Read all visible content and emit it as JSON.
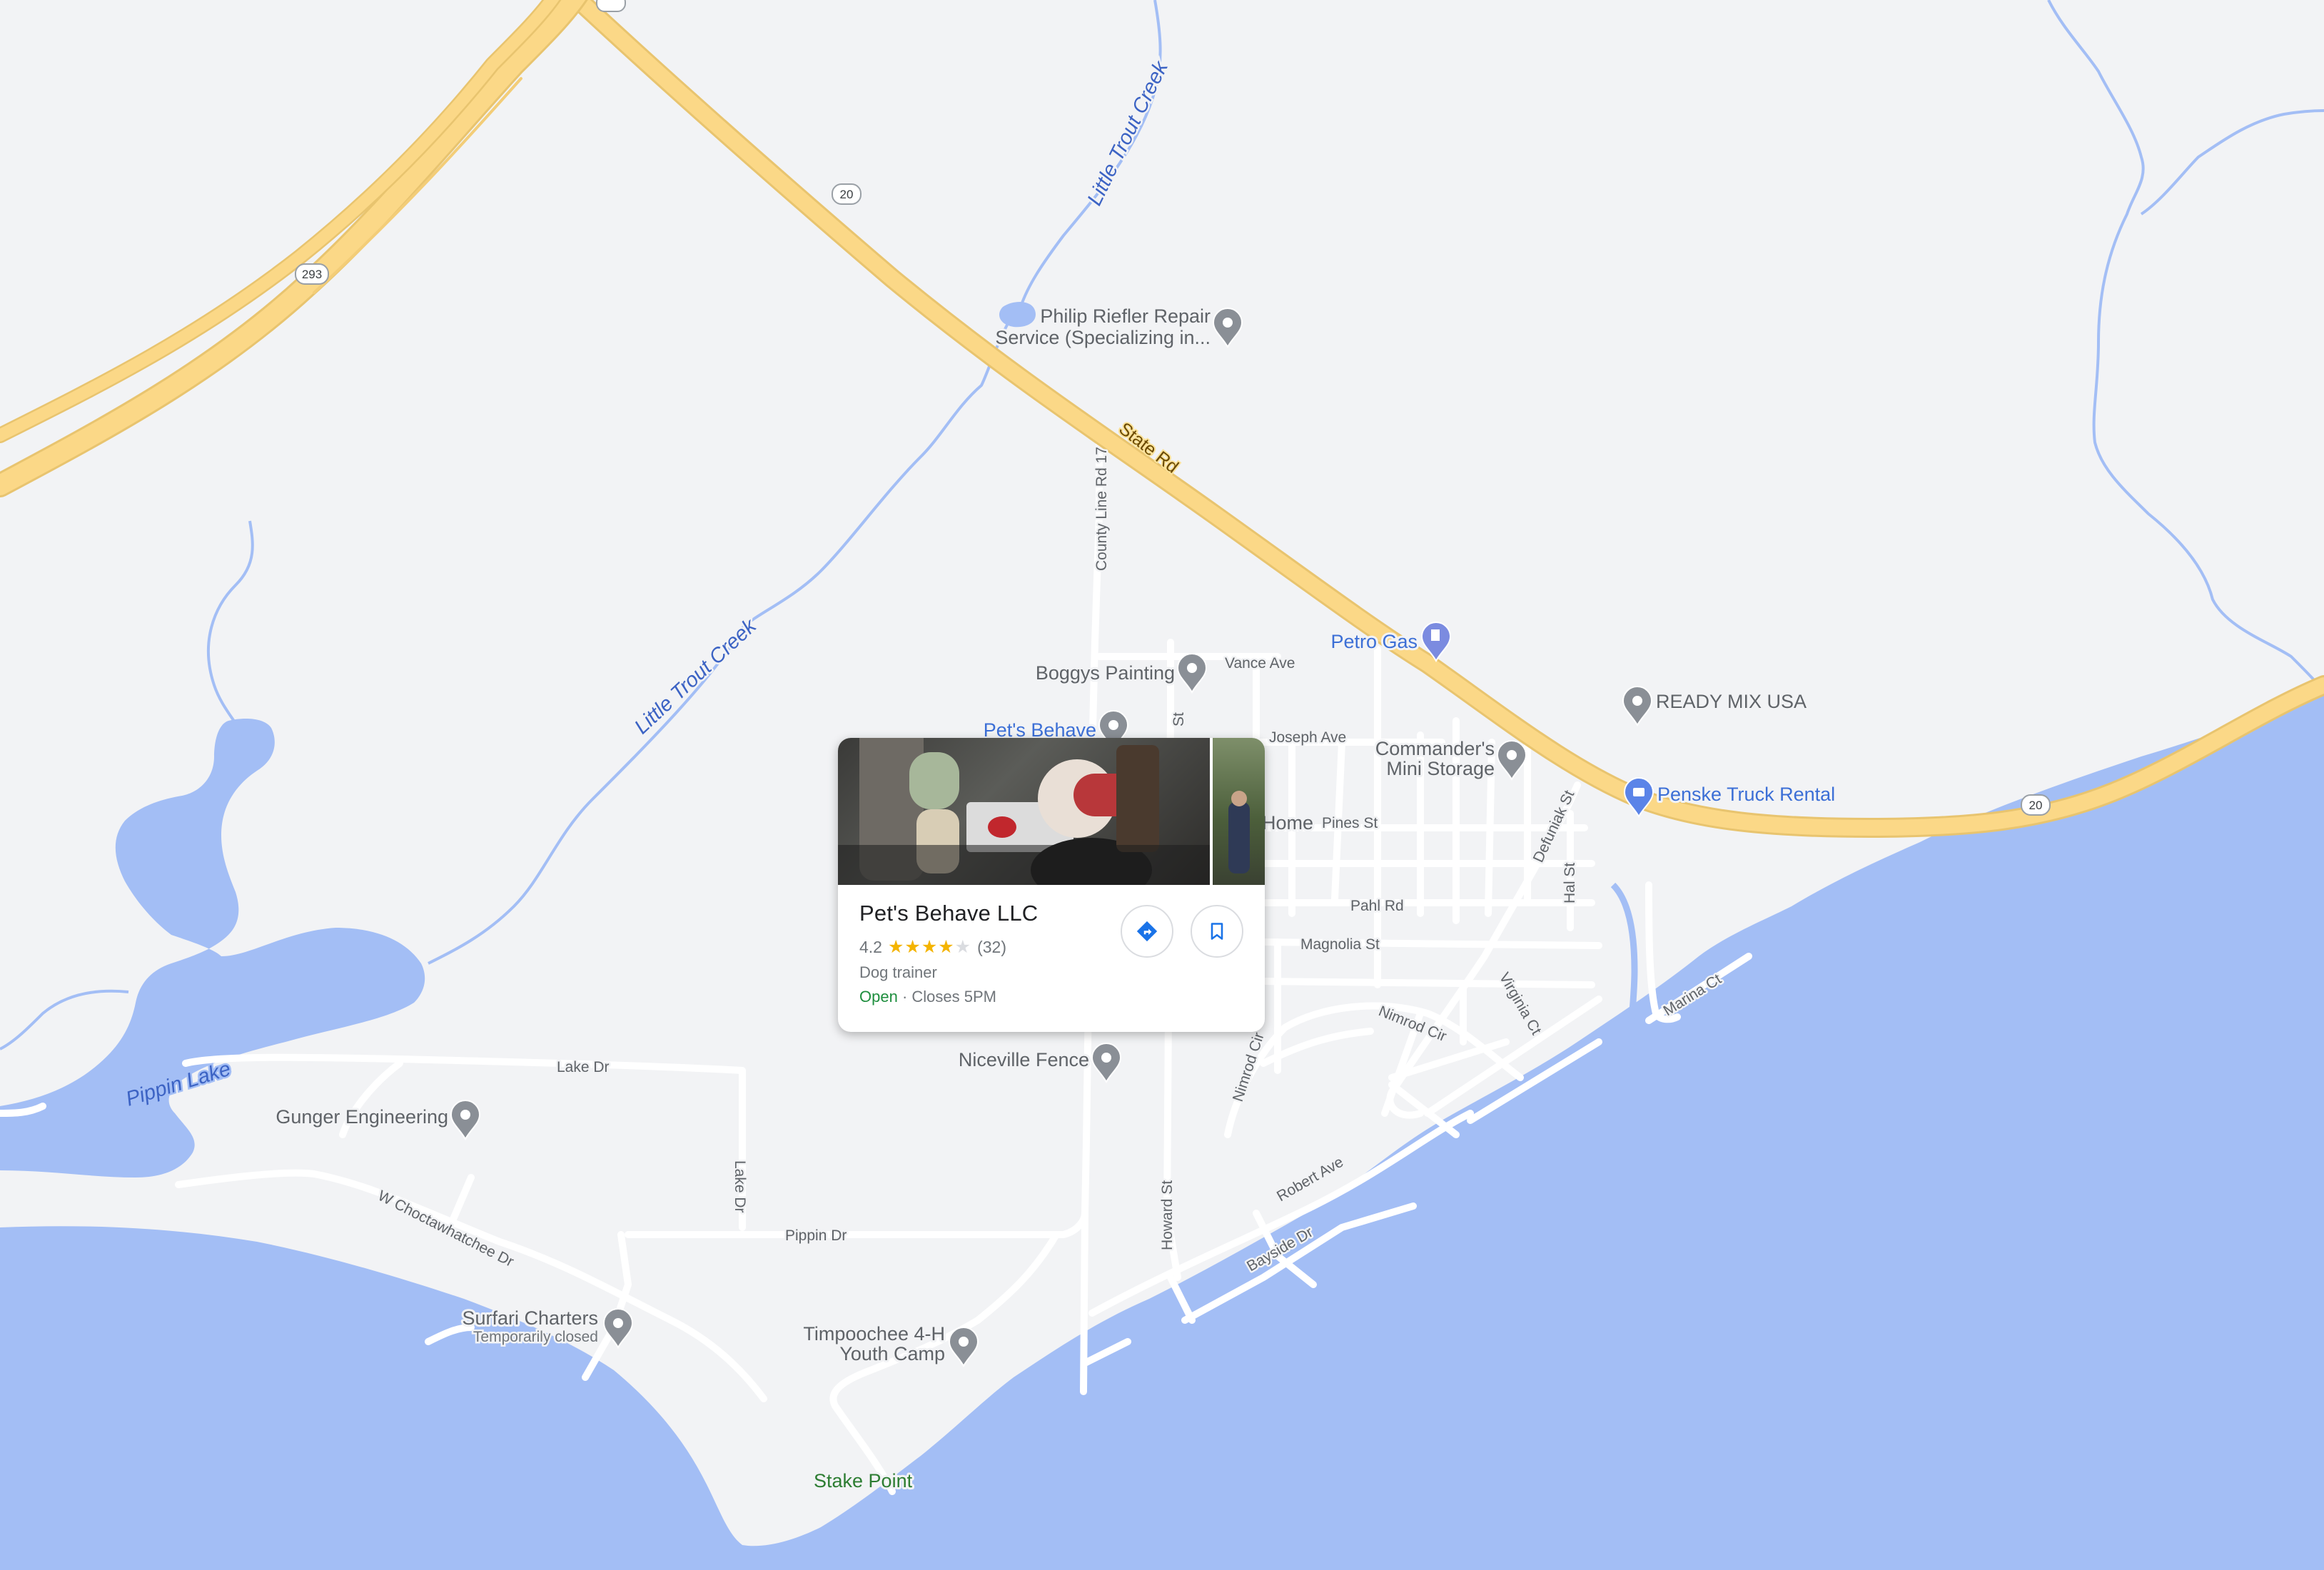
{
  "colors": {
    "land": "#f2f3f5",
    "water": "#a3bef5",
    "highway": "#fbd887",
    "street": "#ffffff",
    "pin": "#8a8f96",
    "accent_blue": "#3c6fd6",
    "open_green": "#1e8e3e"
  },
  "highways": {
    "shield_293": "293",
    "shield_20_north": "20",
    "shield_20_east": "20",
    "state_rd": "State Rd"
  },
  "water": {
    "pippin_lake": "Pippin Lake",
    "creek_north": "Little Trout Creek",
    "creek_south": "Little Trout Creek"
  },
  "streets": {
    "county_line_rd": "County Line Rd 17",
    "vance_ave": "Vance Ave",
    "joseph_ave": "Joseph Ave",
    "pines_st": "Pines St",
    "pahl_rd": "Pahl Rd",
    "magnolia_st": "Magnolia St",
    "nimrod_cir_1": "Nimrod Cir",
    "nimrod_cir_2": "Nimrod Cir",
    "virginia_ct": "Virginia Ct",
    "defuniak_st": "Defuniak St",
    "hal_st": "Hal St",
    "marina_ct": "Marina Ct",
    "robert_ave": "Robert Ave",
    "bayside_dr": "Bayside Dr",
    "howard_st": "Howard St",
    "lake_dr_1": "Lake Dr",
    "lake_dr_2": "Lake Dr",
    "pippin_dr": "Pippin Dr",
    "w_choctawhatchee_dr": "W Choctawhatchee Dr",
    "st_fragment": "St"
  },
  "places": {
    "philip_riefler_line1": "Philip Riefler Repair",
    "philip_riefler_line2": "Service (Specializing in...",
    "petro_gas": "Petro Gas",
    "ready_mix": "READY MIX USA",
    "boggys_painting": "Boggys Painting",
    "pets_behave_map": "Pet's Behave",
    "commanders_line1": "Commander's",
    "commanders_line2": "Mini Storage",
    "penske": "Penske Truck Rental",
    "home": "Home",
    "niceville_fence": "Niceville Fence",
    "gunger_engineering": "Gunger Engineering",
    "surfari_charters": "Surfari Charters",
    "surfari_status": "Temporarily closed",
    "timpoochee_line1": "Timpoochee 4-H",
    "timpoochee_line2": "Youth Camp",
    "stake_point": "Stake Point"
  },
  "card": {
    "title": "Pet's Behave LLC",
    "rating": "4.2",
    "stars": 4.2,
    "review_count": "(32)",
    "category": "Dog trainer",
    "open_status": "Open",
    "separator": "·",
    "hours": "Closes 5PM",
    "directions_icon": "directions-icon",
    "save_icon": "bookmark-icon"
  }
}
